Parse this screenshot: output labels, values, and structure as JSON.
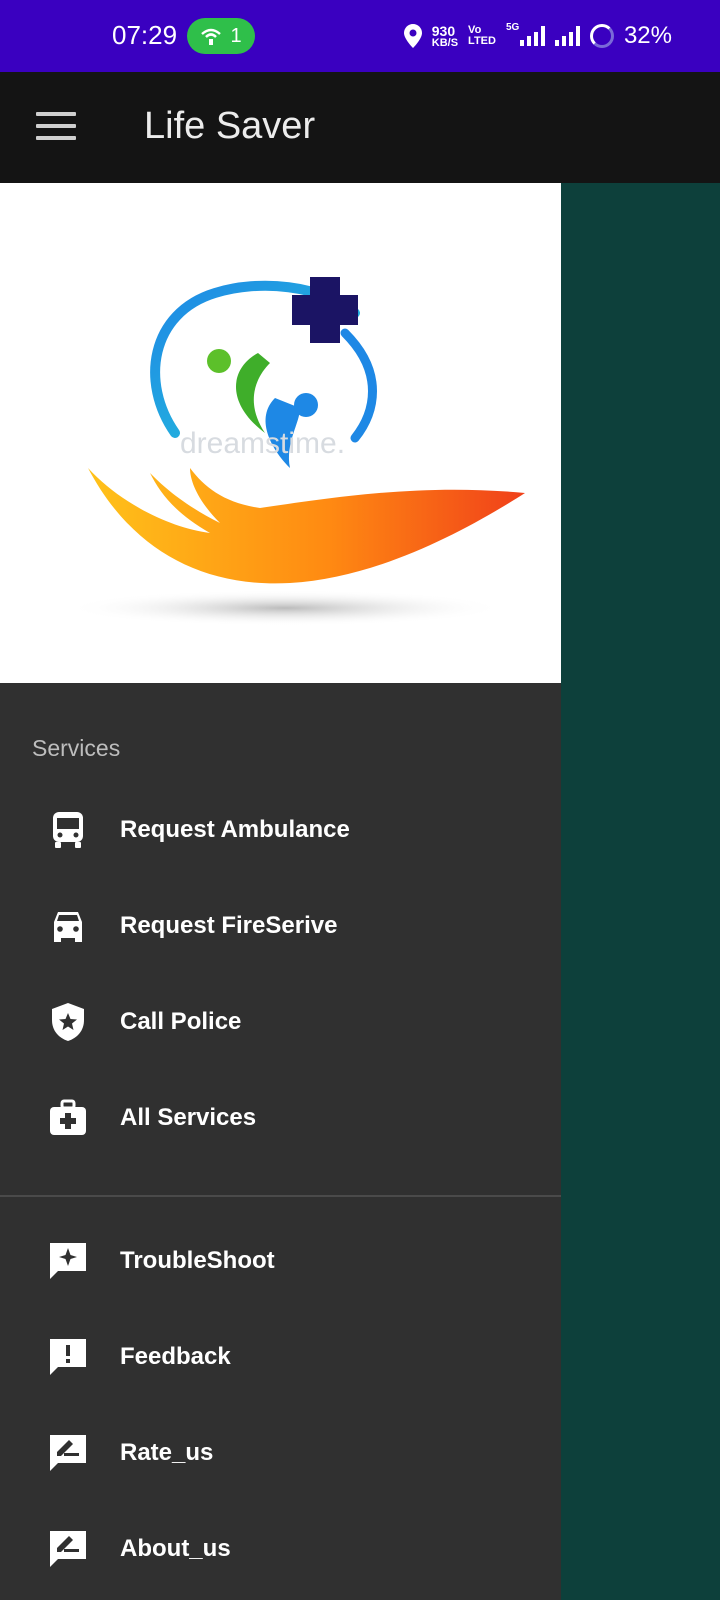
{
  "status_bar": {
    "time": "07:29",
    "hotspot_count": "1",
    "speed_value": "930",
    "speed_unit": "KB/S",
    "volte_top": "Vo",
    "volte_bottom": "LTED",
    "network_type": "5G",
    "battery": "32%",
    "bg_color": "#3a00c0"
  },
  "app_bar": {
    "title": "Life Saver",
    "menu_icon": "hamburger-icon"
  },
  "drawer": {
    "header_logo": "life-saver-logo",
    "logo_watermark": "dreamstime.",
    "section_title": "Services",
    "services": [
      {
        "label": "Request Ambulance",
        "icon": "bus-icon"
      },
      {
        "label": "Request FireSerive",
        "icon": "car-icon"
      },
      {
        "label": "Call Police",
        "icon": "police-shield-icon"
      },
      {
        "label": "All Services",
        "icon": "medical-kit-icon"
      }
    ],
    "other": [
      {
        "label": "TroubleShoot",
        "icon": "sparkle-chat-icon"
      },
      {
        "label": "Feedback",
        "icon": "feedback-icon"
      },
      {
        "label": "Rate_us",
        "icon": "rate-edit-icon"
      },
      {
        "label": "About_us",
        "icon": "about-edit-icon"
      }
    ]
  },
  "colors": {
    "drawer_bg": "#303030",
    "scrim": "#0d403b",
    "app_bar": "#141414"
  }
}
